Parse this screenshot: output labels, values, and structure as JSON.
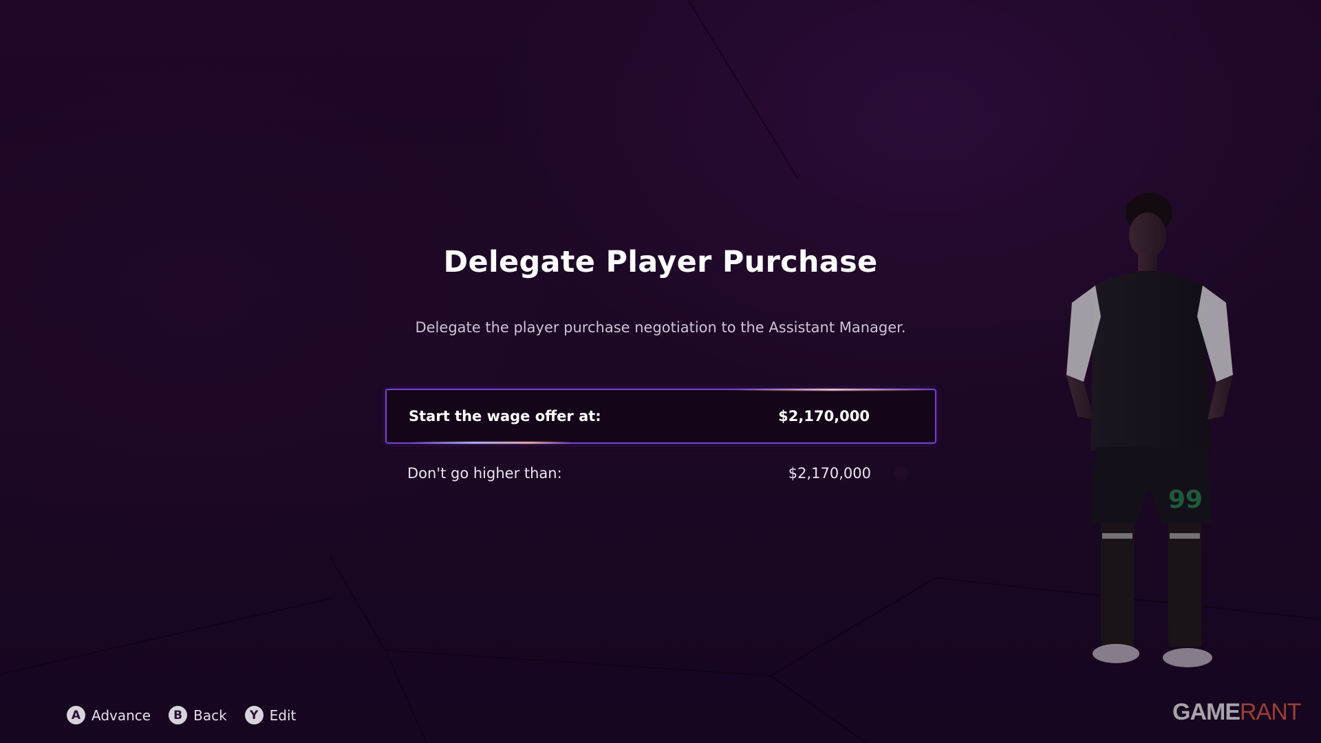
{
  "dialog": {
    "title": "Delegate Player Purchase",
    "subtitle": "Delegate the player purchase negotiation to the Assistant Manager."
  },
  "options": [
    {
      "label": "Start the wage offer at:",
      "value": "$2,170,000",
      "selected": true
    },
    {
      "label": "Don't go higher than:",
      "value": "$2,170,000",
      "selected": false
    }
  ],
  "footer": {
    "hints": [
      {
        "glyph": "A",
        "label": "Advance"
      },
      {
        "glyph": "B",
        "label": "Back"
      },
      {
        "glyph": "Y",
        "label": "Edit"
      }
    ]
  },
  "watermark": {
    "part1": "GAME",
    "part2": "RANT"
  },
  "colors": {
    "background": "#1e0727",
    "accent": "#7a3fd6",
    "selected_bg": "#140519"
  },
  "player": {
    "shirt_number": "99"
  }
}
